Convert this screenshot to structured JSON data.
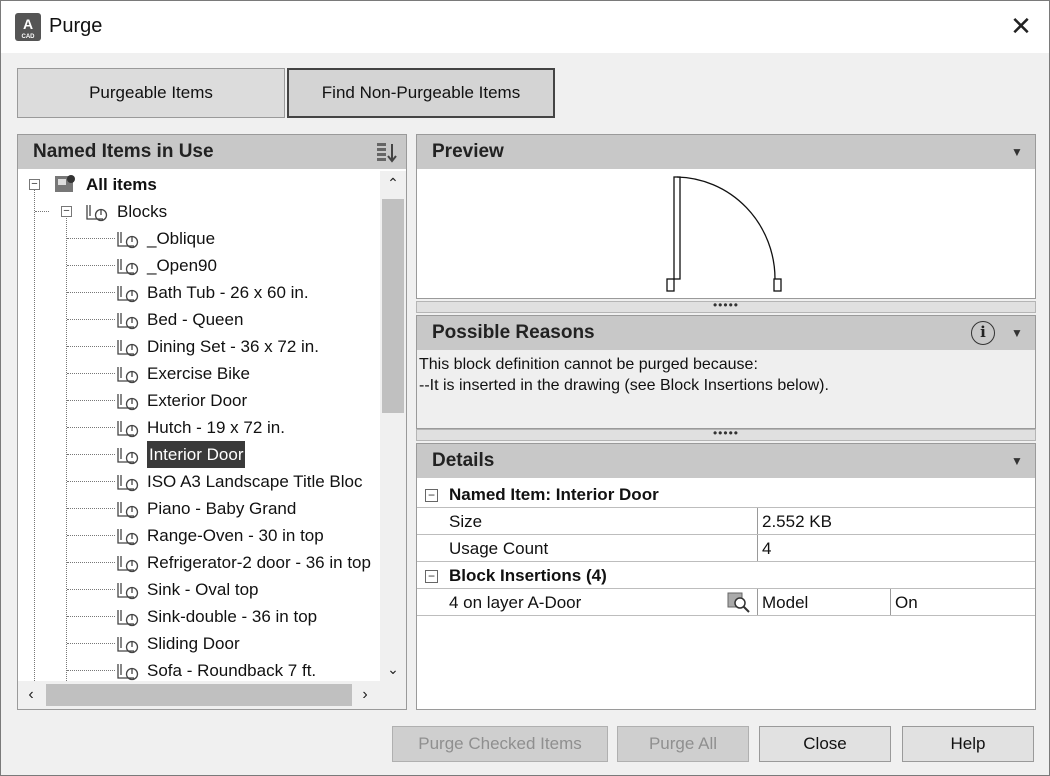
{
  "window": {
    "title": "Purge",
    "app_icon_letter": "A",
    "app_icon_sub": "CAD"
  },
  "tabs": [
    {
      "label": "Purgeable Items"
    },
    {
      "label": "Find Non-Purgeable Items"
    }
  ],
  "tree_panel": {
    "header": "Named Items in Use",
    "root": {
      "label": "All items"
    },
    "group": {
      "label": "Blocks"
    },
    "items": [
      {
        "label": "_Oblique"
      },
      {
        "label": "_Open90"
      },
      {
        "label": "Bath Tub - 26 x 60 in."
      },
      {
        "label": "Bed - Queen"
      },
      {
        "label": "Dining Set - 36 x 72 in."
      },
      {
        "label": "Exercise Bike"
      },
      {
        "label": "Exterior Door"
      },
      {
        "label": "Hutch - 19 x 72 in."
      },
      {
        "label": "Interior Door",
        "selected": true
      },
      {
        "label": "ISO A3 Landscape Title Bloc"
      },
      {
        "label": "Piano - Baby Grand"
      },
      {
        "label": "Range-Oven - 30 in top"
      },
      {
        "label": "Refrigerator-2 door - 36 in top"
      },
      {
        "label": "Sink - Oval top"
      },
      {
        "label": "Sink-double - 36 in top"
      },
      {
        "label": "Sliding Door"
      },
      {
        "label": "Sofa - Roundback 7 ft."
      }
    ]
  },
  "preview": {
    "header": "Preview"
  },
  "reasons": {
    "header": "Possible Reasons",
    "line1": "This block definition cannot be purged because:",
    "line2": "--It is inserted in the drawing (see Block Insertions below)."
  },
  "details": {
    "header": "Details",
    "named_item_group": "Named Item: Interior Door",
    "rows": [
      {
        "label": "Size",
        "value": "2.552 KB"
      },
      {
        "label": "Usage Count",
        "value": "4"
      }
    ],
    "insertions_group": "Block Insertions (4)",
    "insertion": {
      "label": "4 on layer A-Door",
      "space": "Model",
      "state": "On"
    }
  },
  "buttons": {
    "purge_checked": "Purge Checked Items",
    "purge_all": "Purge All",
    "close": "Close",
    "help": "Help"
  },
  "icons": {
    "close": "close-icon",
    "sort": "sort-icon",
    "info": "info-icon",
    "chevron": "chevron-down-icon",
    "zoom": "zoom-to-insertion-icon"
  },
  "colors": {
    "header_bg": "#c8c8c8",
    "selection_bg": "#3a3a3a",
    "window_bg": "#f0f0f0"
  }
}
